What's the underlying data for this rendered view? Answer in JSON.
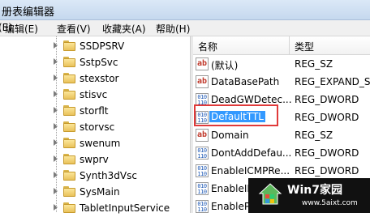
{
  "window": {
    "title": "册表编辑器"
  },
  "menu": [
    "(E)",
    "编辑(E)",
    "查看(V)",
    "收藏夹(A)",
    "帮助(H)"
  ],
  "tree": {
    "items": [
      "SSDPSRV",
      "SstpSvc",
      "stexstor",
      "stisvc",
      "storflt",
      "storvsc",
      "swenum",
      "swprv",
      "Synth3dVsc",
      "SysMain",
      "TabletInputService"
    ]
  },
  "list": {
    "headers": {
      "name": "名称",
      "type": "类型"
    },
    "rows": [
      {
        "name": "(默认)",
        "type": "REG_SZ",
        "icon": "ab"
      },
      {
        "name": "DataBasePath",
        "type": "REG_EXPAND_S",
        "icon": "ab"
      },
      {
        "name": "DeadGWDetec...",
        "type": "REG_DWORD",
        "icon": "bin"
      },
      {
        "name": "DefaultTTL",
        "type": "REG_DWORD",
        "icon": "bin",
        "selected": true
      },
      {
        "name": "Domain",
        "type": "REG_SZ",
        "icon": "ab"
      },
      {
        "name": "DontAddDefau...",
        "type": "REG_DWORD",
        "icon": "bin"
      },
      {
        "name": "EnableICMPRe...",
        "type": "REG_DWORD",
        "icon": "bin"
      },
      {
        "name": "EnableIP",
        "type": "",
        "icon": "bin"
      },
      {
        "name": "EnablePM",
        "type": "",
        "icon": "bin"
      }
    ]
  },
  "watermark": {
    "brand": "Win7家园",
    "url": "www.5aixt.com"
  },
  "colors": {
    "selection": "#3399ff",
    "highlight_box": "#e03a3a"
  }
}
